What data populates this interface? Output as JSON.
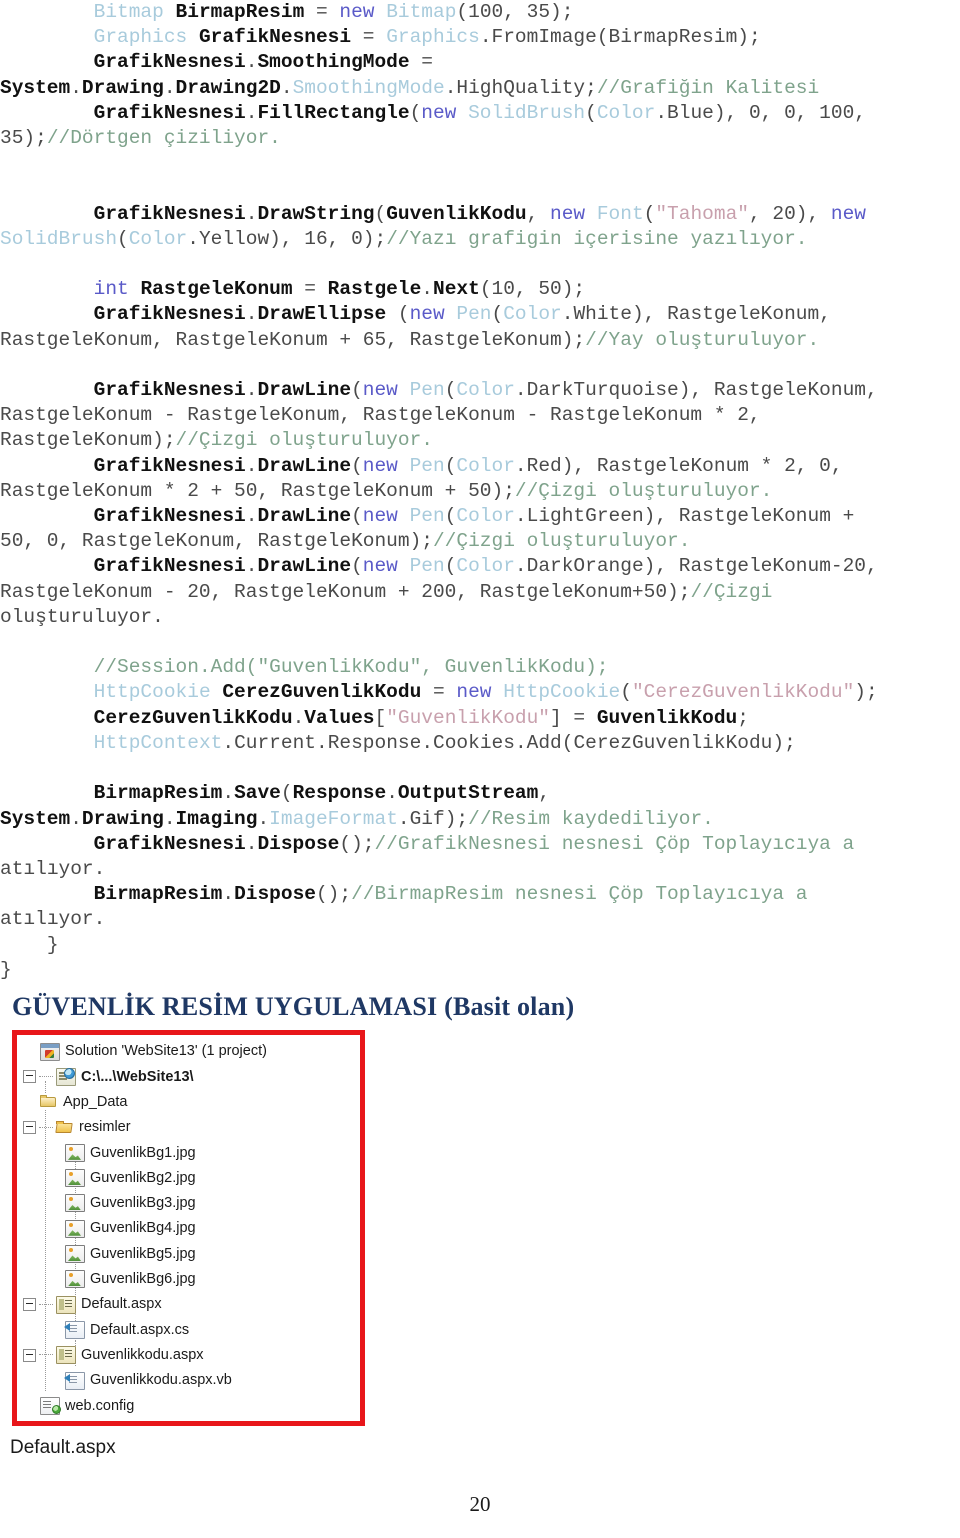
{
  "document": {
    "page_number": "20",
    "caption_default_aspx": "Default.aspx",
    "section_heading": "GÜVENLİK RESİM UYGULAMASI (Basit olan)"
  },
  "code": {
    "language": "csharp",
    "lines": [
      {
        "id": "l1",
        "text": "        Bitmap BirmapResim = new Bitmap(100, 35);"
      },
      {
        "id": "l2",
        "text": "        Graphics GrafikNesnesi = Graphics.FromImage(BirmapResim);"
      },
      {
        "id": "l3",
        "text": "        GrafikNesnesi.SmoothingMode ="
      },
      {
        "id": "l4",
        "text": "System.Drawing.Drawing2D.SmoothingMode.HighQuality;//Grafiğin Kalitesi"
      },
      {
        "id": "l5",
        "text": "        GrafikNesnesi.FillRectangle(new SolidBrush(Color.Blue), 0, 0, 100,"
      },
      {
        "id": "l6",
        "text": "35);//Dörtgen çiziliyor."
      },
      {
        "id": "l7",
        "text": ""
      },
      {
        "id": "l8",
        "text": ""
      },
      {
        "id": "l9",
        "text": "        GrafikNesnesi.DrawString(GuvenlikKodu, new Font(\"Tahoma\", 20), new"
      },
      {
        "id": "l10",
        "text": "SolidBrush(Color.Yellow), 16, 0);//Yazı grafigin içerisine yazılıyor."
      },
      {
        "id": "l11",
        "text": ""
      },
      {
        "id": "l12",
        "text": "        int RastgeleKonum = Rastgele.Next(10, 50);"
      },
      {
        "id": "l13",
        "text": "        GrafikNesnesi.DrawEllipse (new Pen(Color.White), RastgeleKonum,"
      },
      {
        "id": "l14",
        "text": "RastgeleKonum, RastgeleKonum + 65, RastgeleKonum);//Yay oluşturuluyor."
      },
      {
        "id": "l15",
        "text": ""
      },
      {
        "id": "l16",
        "text": "        GrafikNesnesi.DrawLine(new Pen(Color.DarkTurquoise), RastgeleKonum,"
      },
      {
        "id": "l17",
        "text": "RastgeleKonum - RastgeleKonum, RastgeleKonum - RastgeleKonum * 2,"
      },
      {
        "id": "l18",
        "text": "RastgeleKonum);//Çizgi oluşturuluyor."
      },
      {
        "id": "l19",
        "text": "        GrafikNesnesi.DrawLine(new Pen(Color.Red), RastgeleKonum * 2, 0,"
      },
      {
        "id": "l20",
        "text": "RastgeleKonum * 2 + 50, RastgeleKonum + 50);//Çizgi oluşturuluyor."
      },
      {
        "id": "l21",
        "text": "        GrafikNesnesi.DrawLine(new Pen(Color.LightGreen), RastgeleKonum +"
      },
      {
        "id": "l22",
        "text": "50, 0, RastgeleKonum, RastgeleKonum);//Çizgi oluşturuluyor."
      },
      {
        "id": "l23",
        "text": "        GrafikNesnesi.DrawLine(new Pen(Color.DarkOrange), RastgeleKonum-20,"
      },
      {
        "id": "l24",
        "text": "RastgeleKonum - 20, RastgeleKonum + 200, RastgeleKonum+50);//Çizgi"
      },
      {
        "id": "l25",
        "text": "oluşturuluyor."
      },
      {
        "id": "l26",
        "text": ""
      },
      {
        "id": "l27",
        "text": "        //Session.Add(\"GuvenlikKodu\", GuvenlikKodu);"
      },
      {
        "id": "l28",
        "text": "        HttpCookie CerezGuvenlikKodu = new HttpCookie(\"CerezGuvenlikKodu\");"
      },
      {
        "id": "l29",
        "text": "        CerezGuvenlikKodu.Values[\"GuvenlikKodu\"] = GuvenlikKodu;"
      },
      {
        "id": "l30",
        "text": "        HttpContext.Current.Response.Cookies.Add(CerezGuvenlikKodu);"
      },
      {
        "id": "l31",
        "text": ""
      },
      {
        "id": "l32",
        "text": "        BirmapResim.Save(Response.OutputStream,"
      },
      {
        "id": "l33",
        "text": "System.Drawing.Imaging.ImageFormat.Gif);//Resim kaydediliyor."
      },
      {
        "id": "l34",
        "text": "        GrafikNesnesi.Dispose();//GrafikNesnesi nesnesi Çöp Toplayıcıya a"
      },
      {
        "id": "l35",
        "text": "atılıyor."
      },
      {
        "id": "l36",
        "text": "        BirmapResim.Dispose();//BirmapResim nesnesi Çöp Toplayıcıya a"
      },
      {
        "id": "l37",
        "text": "atılıyor."
      },
      {
        "id": "l38",
        "text": "    }"
      },
      {
        "id": "l39",
        "text": "}"
      }
    ],
    "colors": {
      "type": "#a8cbdc",
      "keyword": "#5a5ac8",
      "comment": "#7fa38c",
      "string": "#c8a0ad",
      "identifier": "#4a4a4a",
      "bold_member": "#111111"
    }
  },
  "solution_explorer": {
    "frame_color": "#e8161a",
    "nodes": [
      {
        "label": "Solution 'WebSite13' (1 project)",
        "icon": "solution-icon",
        "depth": 0,
        "expander": false,
        "bold": false
      },
      {
        "label": "C:\\...\\WebSite13\\",
        "icon": "web-project-icon",
        "depth": 0,
        "expander": true,
        "bold": true
      },
      {
        "label": "App_Data",
        "icon": "folder-closed-icon",
        "depth": 1,
        "expander": false,
        "bold": false
      },
      {
        "label": "resimler",
        "icon": "folder-open-icon",
        "depth": 1,
        "expander": true,
        "bold": false
      },
      {
        "label": "GuvenlikBg1.jpg",
        "icon": "image-file-icon",
        "depth": 2,
        "expander": false,
        "bold": false
      },
      {
        "label": "GuvenlikBg2.jpg",
        "icon": "image-file-icon",
        "depth": 2,
        "expander": false,
        "bold": false
      },
      {
        "label": "GuvenlikBg3.jpg",
        "icon": "image-file-icon",
        "depth": 2,
        "expander": false,
        "bold": false
      },
      {
        "label": "GuvenlikBg4.jpg",
        "icon": "image-file-icon",
        "depth": 2,
        "expander": false,
        "bold": false
      },
      {
        "label": "GuvenlikBg5.jpg",
        "icon": "image-file-icon",
        "depth": 2,
        "expander": false,
        "bold": false
      },
      {
        "label": "GuvenlikBg6.jpg",
        "icon": "image-file-icon",
        "depth": 2,
        "expander": false,
        "bold": false
      },
      {
        "label": "Default.aspx",
        "icon": "aspx-page-icon",
        "depth": 1,
        "expander": true,
        "bold": false
      },
      {
        "label": "Default.aspx.cs",
        "icon": "code-behind-icon",
        "depth": 2,
        "expander": false,
        "bold": false
      },
      {
        "label": "Guvenlikkodu.aspx",
        "icon": "aspx-page-icon",
        "depth": 1,
        "expander": true,
        "bold": false
      },
      {
        "label": "Guvenlikkodu.aspx.vb",
        "icon": "code-behind-icon",
        "depth": 2,
        "expander": false,
        "bold": false
      },
      {
        "label": "web.config",
        "icon": "config-file-icon",
        "depth": 1,
        "expander": false,
        "bold": false
      }
    ]
  }
}
